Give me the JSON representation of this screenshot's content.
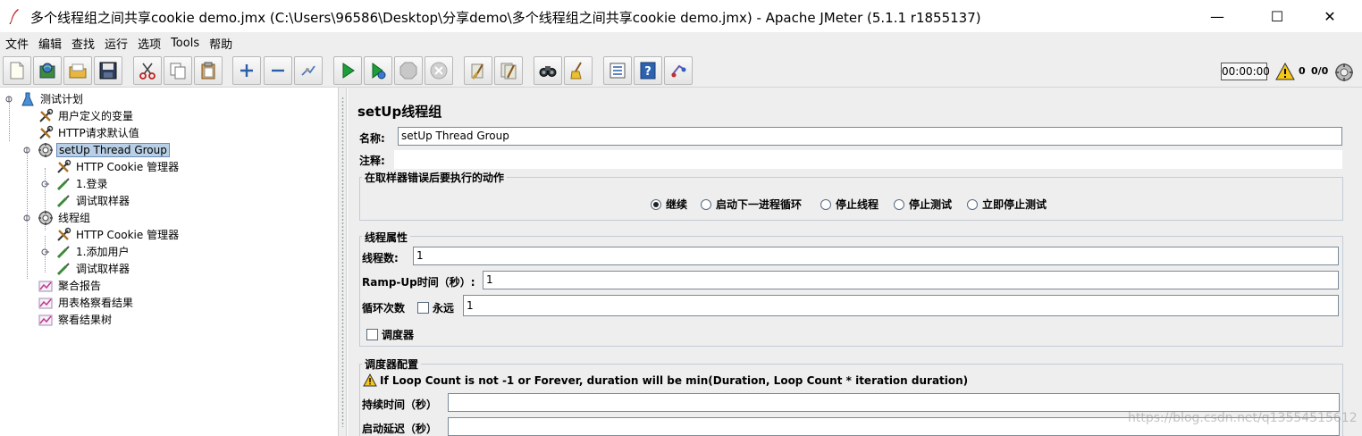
{
  "window": {
    "title": "多个线程组之间共享cookie demo.jmx (C:\\Users\\96586\\Desktop\\分享demo\\多个线程组之间共享cookie demo.jmx) - Apache JMeter (5.1.1 r1855137)",
    "minimize_glyph": "—",
    "maximize_glyph": "☐",
    "close_glyph": "✕"
  },
  "menu": {
    "items": [
      "文件",
      "编辑",
      "查找",
      "运行",
      "选项",
      "Tools",
      "帮助"
    ]
  },
  "toolbar": {
    "buttons": [
      "new-icon",
      "templates-icon",
      "open-icon",
      "save-icon",
      "cut-icon",
      "copy-icon",
      "paste-icon",
      "expand-icon",
      "collapse-icon",
      "toggle-icon",
      "start-icon",
      "start-no-pause-icon",
      "stop-icon",
      "shutdown-icon",
      "clear-icon",
      "clear-all-icon",
      "search-icon",
      "reset-search-icon",
      "function-helper-icon",
      "help-icon",
      "remote-icon"
    ],
    "timer": "00:00:00",
    "error_count": "0",
    "thread_count": "0/0"
  },
  "tree": {
    "nodes": [
      {
        "label": "测试计划",
        "icon": "test-plan-icon"
      },
      {
        "label": "用户定义的变量",
        "icon": "config-wrench-icon"
      },
      {
        "label": "HTTP请求默认值",
        "icon": "config-wrench-icon"
      },
      {
        "label": "setUp Thread Group",
        "icon": "thread-group-gear-icon"
      },
      {
        "label": "HTTP Cookie 管理器",
        "icon": "config-wrench-icon"
      },
      {
        "label": "1.登录",
        "icon": "sampler-pipette-icon"
      },
      {
        "label": "调试取样器",
        "icon": "sampler-pipette-icon"
      },
      {
        "label": "线程组",
        "icon": "thread-group-gear-icon"
      },
      {
        "label": "HTTP Cookie 管理器",
        "icon": "config-wrench-icon"
      },
      {
        "label": "1.添加用户",
        "icon": "sampler-pipette-icon"
      },
      {
        "label": "调试取样器",
        "icon": "sampler-pipette-icon"
      },
      {
        "label": "聚合报告",
        "icon": "listener-chart-icon"
      },
      {
        "label": "用表格察看结果",
        "icon": "listener-chart-icon"
      },
      {
        "label": "察看结果树",
        "icon": "listener-chart-icon"
      }
    ]
  },
  "panel": {
    "heading": "setUp线程组",
    "name_label": "名称:",
    "name_value": "setUp Thread Group",
    "comment_label": "注释:",
    "comment_value": "",
    "on_error": {
      "title": "在取样器错误后要执行的动作",
      "options": [
        "继续",
        "启动下一进程循环",
        "停止线程",
        "停止测试",
        "立即停止测试"
      ],
      "selected": "继续"
    },
    "thread_props": {
      "title": "线程属性",
      "threads_label": "线程数:",
      "threads_value": "1",
      "rampup_label": "Ramp-Up时间（秒）:",
      "rampup_value": "1",
      "loop_label": "循环次数",
      "forever_label": "永远",
      "loop_value": "1",
      "scheduler_label": "调度器"
    },
    "scheduler": {
      "title": "调度器配置",
      "warning": "If Loop Count is not -1 or Forever, duration will be min(Duration, Loop Count * iteration duration)",
      "duration_label": "持续时间（秒）",
      "delay_label": "启动延迟（秒）"
    }
  },
  "watermark": "https://blog.csdn.net/q13554515612"
}
